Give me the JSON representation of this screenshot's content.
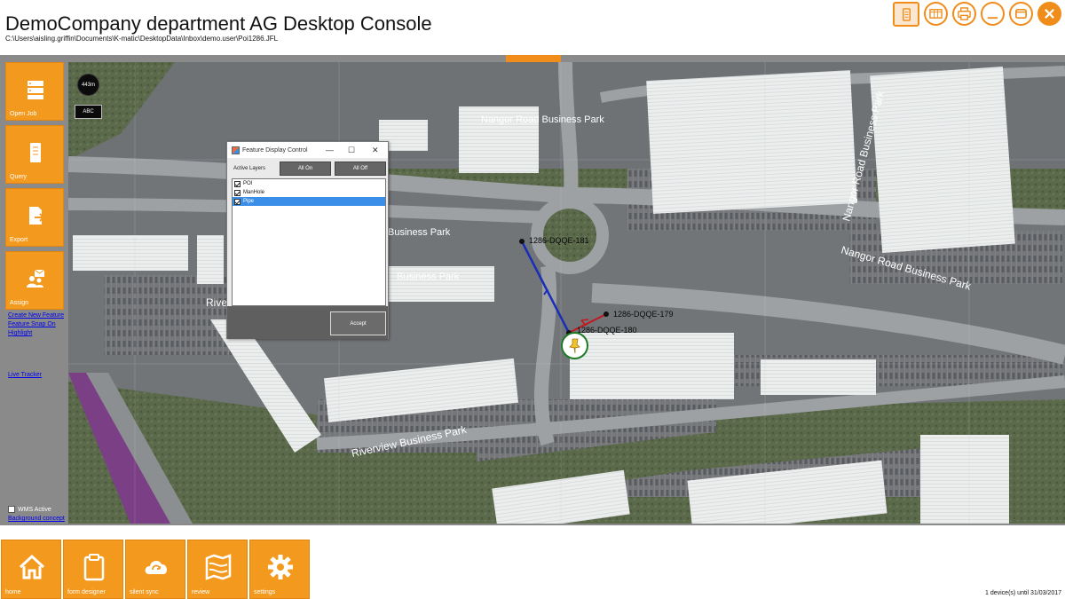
{
  "app": {
    "title": "DemoCompany department AG Desktop Console",
    "file_path": "C:\\Users\\aisling.griffin\\Documents\\K-matic\\DesktopData\\Inbox\\demo.user\\Poi1286.JFL"
  },
  "window_controls": [
    "form-icon",
    "table-icon",
    "printer-icon",
    "minimize-icon",
    "restore-icon",
    "close-icon"
  ],
  "sidebar": {
    "buttons": [
      {
        "label": "Open Job",
        "icon": "server-stack-icon"
      },
      {
        "label": "Query",
        "icon": "mobile-device-icon"
      },
      {
        "label": "Export",
        "icon": "export-document-icon"
      },
      {
        "label": "Assign",
        "icon": "assign-users-icon"
      }
    ],
    "links": [
      "Create New Feature",
      "Feature Snap On",
      "Highlight",
      "Live Tracker"
    ],
    "wms_label": "WMS Active",
    "wms_checked": false,
    "background_link": "Background concept"
  },
  "map": {
    "scale_label": "443m",
    "abc_label": "ABC",
    "place_labels": [
      "Nangor Road Business Park",
      "Nangor Road Business Park",
      "Nangor Road Business Park",
      "Business Park",
      "Business Park",
      "Riverview Business Park",
      "Riverview"
    ],
    "features": [
      {
        "label": "1286-DQQE-181"
      },
      {
        "label": "1286-DQQE-179"
      },
      {
        "label": "1286-DQQE-180"
      }
    ]
  },
  "dialog": {
    "title": "Feature Display Control",
    "active_layers_label": "Active Layers",
    "all_on": "All On",
    "all_off": "All Off",
    "layers": [
      {
        "name": "POI",
        "checked": true,
        "selected": false
      },
      {
        "name": "ManHole",
        "checked": true,
        "selected": false
      },
      {
        "name": "Pipe",
        "checked": true,
        "selected": true
      }
    ],
    "accept": "Accept"
  },
  "bottom_bar": {
    "buttons": [
      {
        "label": "home",
        "icon": "home-icon"
      },
      {
        "label": "form designer",
        "icon": "clipboard-icon"
      },
      {
        "label": "silent sync",
        "icon": "cloud-sync-icon"
      },
      {
        "label": "review",
        "icon": "map-review-icon"
      },
      {
        "label": "settings",
        "icon": "gear-icon"
      }
    ]
  },
  "status": "1 device(s) until 31/03/2017",
  "colors": {
    "accent": "#f39a1e",
    "frame": "#8a8a8a",
    "selection": "#3a8ee8",
    "pipe_line": "#1a2db8"
  }
}
